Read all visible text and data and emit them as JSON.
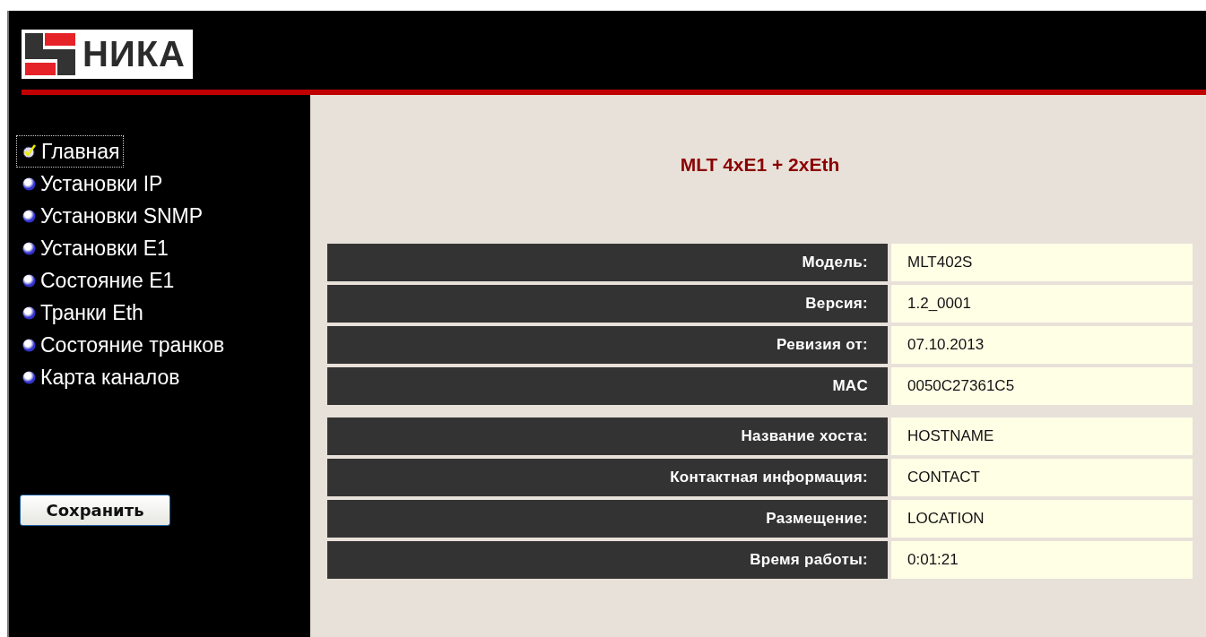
{
  "header": {
    "logo_text": "НИКА"
  },
  "menu": [
    {
      "label": "Главная",
      "selected": true
    },
    {
      "label": "Установки IP",
      "selected": false
    },
    {
      "label": "Установки SNMP",
      "selected": false
    },
    {
      "label": "Установки E1",
      "selected": false
    },
    {
      "label": "Состояние E1",
      "selected": false
    },
    {
      "label": "Транки Eth",
      "selected": false
    },
    {
      "label": "Состояние транков",
      "selected": false
    },
    {
      "label": "Карта каналов",
      "selected": false
    }
  ],
  "save_button": "Сохранить",
  "title": "MLT 4xE1 + 2xEth",
  "groups": [
    {
      "rows": [
        {
          "label": "Модель:",
          "value": "MLT402S"
        },
        {
          "label": "Версия:",
          "value": "1.2_0001"
        },
        {
          "label": "Ревизия от:",
          "value": "07.10.2013"
        },
        {
          "label": "MAC",
          "value": "0050C27361C5"
        }
      ]
    },
    {
      "rows": [
        {
          "label": "Название хоста:",
          "value": "HOSTNAME"
        },
        {
          "label": "Контактная информация:",
          "value": "CONTACT"
        },
        {
          "label": "Размещение:",
          "value": "LOCATION"
        },
        {
          "label": "Время работы:",
          "value": "0:01:21"
        }
      ]
    }
  ]
}
